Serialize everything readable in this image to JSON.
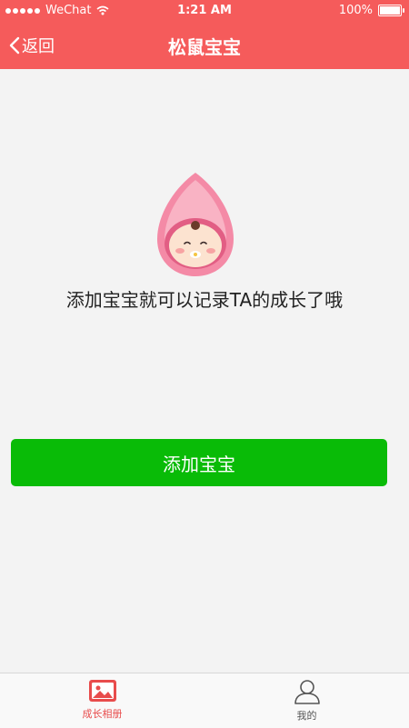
{
  "status_bar": {
    "carrier": "WeChat",
    "time": "1:21 AM",
    "battery": "100%",
    "icons": [
      "signal-dots-icon",
      "wifi-icon",
      "battery-icon"
    ]
  },
  "nav": {
    "back_label": "返回",
    "title": "松鼠宝宝"
  },
  "main": {
    "illustration": "baby-in-pink-hood",
    "message": "添加宝宝就可以记录TA的成长了哦",
    "add_button_label": "添加宝宝"
  },
  "tabbar": {
    "tabs": [
      {
        "label": "成长相册",
        "icon": "photo-album-icon",
        "active": true
      },
      {
        "label": "我的",
        "icon": "person-icon",
        "active": false
      }
    ]
  },
  "colors": {
    "header": "#f55b5b",
    "primary_button": "#09bb07",
    "active_tab": "#e84c4c",
    "background": "#f3f3f3"
  }
}
